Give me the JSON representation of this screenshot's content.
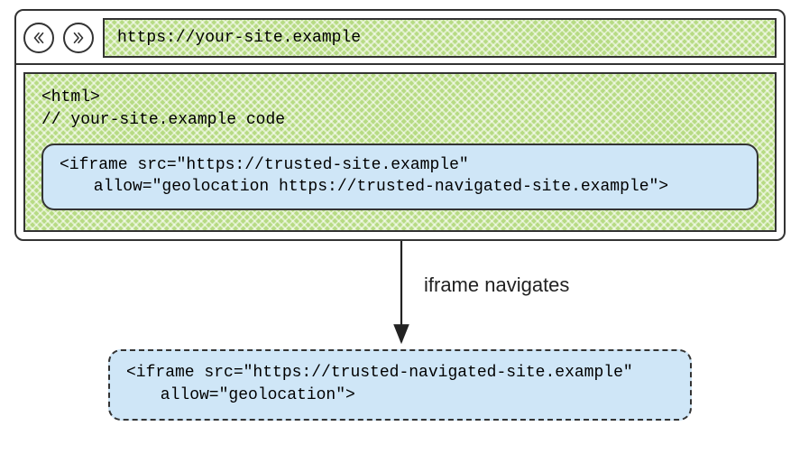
{
  "address_bar": {
    "url": "https://your-site.example"
  },
  "page_code": {
    "line1": "<html>",
    "line2": "// your-site.example code"
  },
  "iframe_initial": {
    "line1": "<iframe src=\"https://trusted-site.example\"",
    "line2": "    allow=\"geolocation https://trusted-navigated-site.example\">"
  },
  "arrow_label": "iframe navigates",
  "iframe_navigated": {
    "line1": "<iframe src=\"https://trusted-navigated-site.example\"",
    "line2": "    allow=\"geolocation\">"
  },
  "colors": {
    "green_hatch": "#b7db84",
    "blue_fill": "#cfe6f7",
    "border": "#333333"
  }
}
